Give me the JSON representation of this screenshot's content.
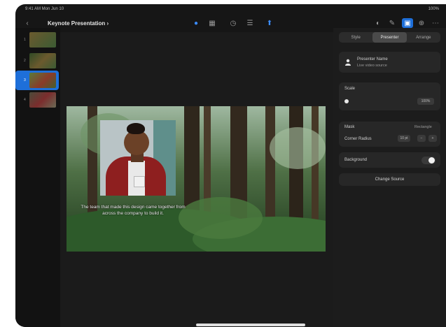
{
  "status": {
    "time": "9:41 AM Mon Jun 10",
    "system": "100%"
  },
  "toolbar": {
    "back_icon": "chevron-left-icon",
    "document_title": "Keynote Presentation",
    "chevron": "›",
    "left_tools": [
      "●",
      "▦",
      "◷",
      "☰",
      "⬆"
    ],
    "right_tools": [
      "◐",
      "✎",
      "▣",
      "⊕",
      "⋯"
    ]
  },
  "slides": {
    "numbers": [
      "1",
      "2",
      "3",
      "4"
    ]
  },
  "slide": {
    "caption": "The team that made this design came together from across the company to build it."
  },
  "inspector": {
    "tabs": [
      "Style",
      "Presenter",
      "Arrange"
    ],
    "active_tab": "Presenter",
    "presenter_name": "Presenter Name",
    "presenter_sub": "Live video source",
    "scale_label": "Scale",
    "scale_value": "100%",
    "mask_label": "Mask",
    "mask_value": "Rectangle",
    "corner_label": "Corner Radius",
    "corner_value": "10 pt",
    "background_label": "Background",
    "edit_button": "Change Source"
  }
}
